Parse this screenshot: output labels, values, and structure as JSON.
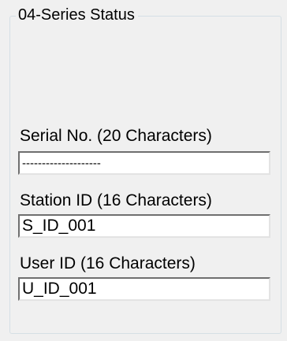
{
  "group": {
    "title": "04-Series Status"
  },
  "fields": {
    "serial": {
      "label": "Serial No. (20 Characters)",
      "value": "--------------------"
    },
    "station": {
      "label": "Station ID (16 Characters)",
      "value": "S_ID_001"
    },
    "user": {
      "label": "User ID (16 Characters)",
      "value": "U_ID_001"
    }
  }
}
